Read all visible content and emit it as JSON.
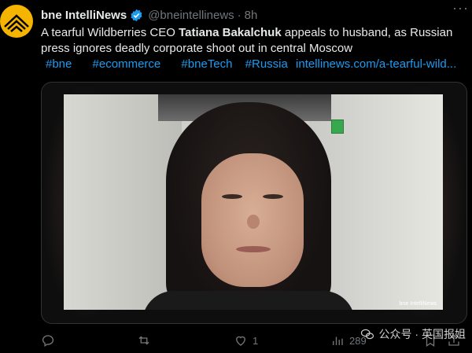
{
  "tweet": {
    "display_name": "bne IntelliNews",
    "handle": "@bneintellinews",
    "dot": "·",
    "time": "8h",
    "text_pre": "A tearful Wildberries CEO ",
    "text_bold": "Tatiana Bakalchuk",
    "text_post": " appeals to husband, as Russian press ignores deadly corporate shoot out in central Moscow",
    "hashtags": [
      "#bne",
      "#ecommerce",
      "#bneTech",
      "#Russia"
    ],
    "link": "intellinews.com/a-tearful-wild..."
  },
  "media": {
    "watermark": "bne IntelliNews"
  },
  "actions": {
    "likes": "1",
    "views": "289"
  },
  "overlay": {
    "wechat_label": "公众号 · 英国报姐"
  },
  "colors": {
    "accent": "#1d9bf0",
    "avatar": "#f5b400",
    "muted": "#71767b"
  },
  "icons": [
    "avatar-logo",
    "verified-badge-icon",
    "more-icon",
    "reply-icon",
    "retweet-icon",
    "like-icon",
    "views-icon",
    "bookmark-icon",
    "share-icon",
    "wechat-icon"
  ]
}
